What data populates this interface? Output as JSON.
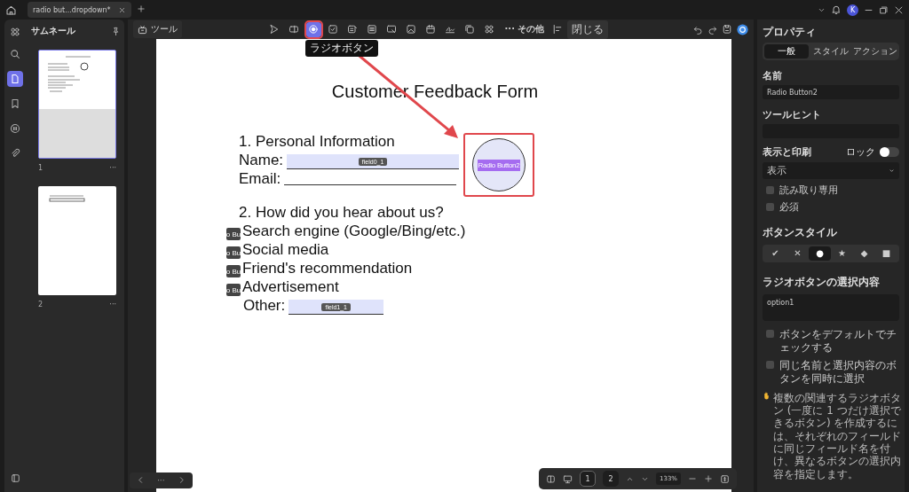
{
  "tabs": [
    {
      "title": "radio but...dropdown*",
      "selected": true
    }
  ],
  "account": {
    "initial": "K"
  },
  "rail": [
    {
      "selected": false
    },
    {
      "selected": true
    },
    {
      "selected": false
    },
    {
      "selected": false
    },
    {
      "selected": false
    }
  ],
  "thumbnails": {
    "title": "サムネール",
    "pages": [
      {
        "label": "1",
        "more": "···",
        "selected": true
      },
      {
        "label": "2",
        "more": "···",
        "selected": false
      }
    ]
  },
  "toolbar": {
    "tools_label": "ツール",
    "tools": [
      {
        "selected": false
      },
      {
        "selected": false
      },
      {
        "selected": true
      },
      {
        "selected": false
      },
      {
        "selected": false
      },
      {
        "selected": false
      },
      {
        "selected": false
      },
      {
        "selected": false
      },
      {
        "selected": false
      },
      {
        "selected": false
      },
      {
        "selected": false
      },
      {
        "selected": false
      }
    ],
    "more": "··· その他",
    "close": "閉じる",
    "tooltip": "ラジオボタン"
  },
  "document": {
    "title": "Customer Feedback Form",
    "section_1": "1. Personal Information",
    "name_label": "Name:",
    "name_field": "field0_1",
    "email_label": "Email:",
    "section_2": "2. How did you hear about us?",
    "options": [
      {
        "tag": "o Bu",
        "text": "Search engine (Google/Bing/etc.)"
      },
      {
        "tag": "o Bu",
        "text": "Social media"
      },
      {
        "tag": "o Bu",
        "text": "Friend's recommendation"
      },
      {
        "tag": "o Bu",
        "text": "Advertisement"
      }
    ],
    "other_label": "Other:",
    "other_field": "field1_1",
    "radio_widget": "Radio Button2"
  },
  "pager": {
    "more": "···"
  },
  "bottom_bar": {
    "pages": [
      {
        "label": "1",
        "selected": true
      },
      {
        "label": "2",
        "selected": false
      }
    ],
    "zoom": "133%"
  },
  "properties": {
    "title": "プロパティ",
    "tabs": [
      {
        "label": "一般",
        "selected": true
      },
      {
        "label": "スタイル",
        "selected": false
      },
      {
        "label": "アクション",
        "selected": false
      }
    ],
    "name_label": "名前",
    "name_value": "Radio Button2",
    "tooltip_label": "ツールヒント",
    "visibility_label": "表示と印刷",
    "lock_label": "ロック",
    "lock_on": false,
    "visibility_value": "表示",
    "flags": [
      {
        "label": "読み取り専用",
        "checked": false
      },
      {
        "label": "必須",
        "checked": false
      }
    ],
    "style_label": "ボタンスタイル",
    "styles": [
      {
        "glyph": "✔",
        "selected": false
      },
      {
        "glyph": "✕",
        "selected": false
      },
      {
        "glyph": "●",
        "selected": true
      },
      {
        "glyph": "★",
        "selected": false
      },
      {
        "glyph": "◆",
        "selected": false
      },
      {
        "glyph": "■",
        "selected": false
      }
    ],
    "choice_label": "ラジオボタンの選択内容",
    "choice_value": "option1",
    "options": [
      {
        "label": "ボタンをデフォルトでチェックする",
        "checked": false
      },
      {
        "label": "同じ名前と選択内容のボタンを同時に選択",
        "checked": false
      }
    ],
    "hint": "複数の関連するラジオボタン (一度に 1 つだけ選択できるボタン) を作成するには、それぞれのフィールドに同じフィールド名を付け、異なるボタンの選択内容を指定します。"
  }
}
